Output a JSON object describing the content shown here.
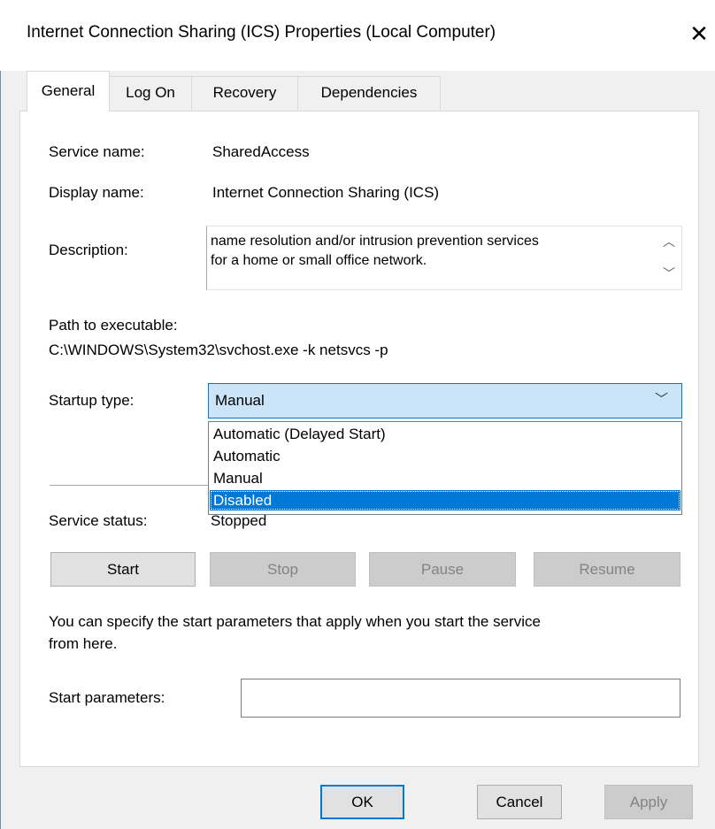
{
  "window": {
    "title": "Internet Connection Sharing (ICS) Properties (Local Computer)",
    "close_glyph": "✕"
  },
  "tabs": [
    {
      "label": "General",
      "active": true
    },
    {
      "label": "Log On",
      "active": false
    },
    {
      "label": "Recovery",
      "active": false
    },
    {
      "label": "Dependencies",
      "active": false
    }
  ],
  "general": {
    "service_name_label": "Service name:",
    "service_name_value": "SharedAccess",
    "display_name_label": "Display name:",
    "display_name_value": "Internet Connection Sharing (ICS)",
    "description_label": "Description:",
    "description_line1": "name resolution and/or intrusion prevention services",
    "description_line2": "for a home or small office network.",
    "path_label": "Path to executable:",
    "path_value": "C:\\WINDOWS\\System32\\svchost.exe -k netsvcs -p",
    "startup_label": "Startup type:",
    "startup_value": "Manual",
    "startup_options": [
      "Automatic (Delayed Start)",
      "Automatic",
      "Manual",
      "Disabled"
    ],
    "startup_highlighted": "Disabled",
    "status_label": "Service status:",
    "status_value": "Stopped",
    "buttons": {
      "start": "Start",
      "stop": "Stop",
      "pause": "Pause",
      "resume": "Resume"
    },
    "hint_line1": "You can specify the start parameters that apply when you start the service",
    "hint_line2": "from here.",
    "params_label": "Start parameters:",
    "params_value": ""
  },
  "footer": {
    "ok": "OK",
    "cancel": "Cancel",
    "apply": "Apply"
  },
  "colors": {
    "accent": "#0078d7",
    "combo_bg": "#cce4f7",
    "dialog_bg": "#f0f0f0"
  }
}
